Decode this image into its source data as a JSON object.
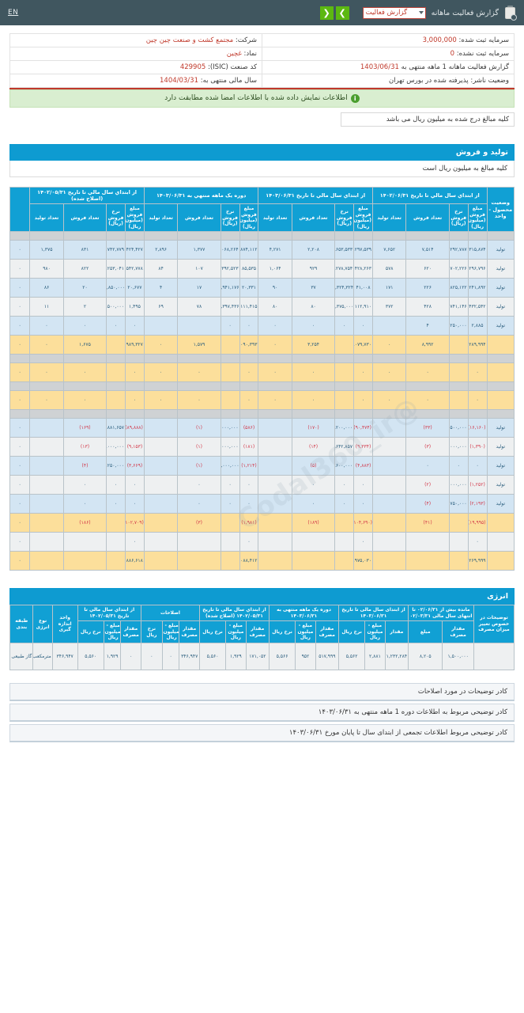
{
  "topbar": {
    "lang_link": "EN",
    "clipboard_icon": "clipboard-check-icon",
    "title": "گزارش فعالیت ماهانه",
    "report_select_value": "گزارش فعالیت",
    "prev_label": "❮",
    "next_label": "❯"
  },
  "info": {
    "company_label": "شرکت:",
    "company_value": "مجتمع کشت و صنعت چین چین",
    "symbol_label": "نماد:",
    "symbol_value": "غچین",
    "isic_label": "کد صنعت (ISIC):",
    "isic_value": "429905",
    "fiscal_year_label": "سال مالی منتهی به:",
    "fiscal_year_value": "1404/03/31",
    "registered_capital_label": "سرمایه ثبت شده:",
    "registered_capital_value": "3,000,000",
    "unregistered_capital_label": "سرمایه ثبت نشده:",
    "unregistered_capital_value": "0",
    "period_label": "گزارش فعالیت ماهانه  1 ماهه منتهی به",
    "period_value": "1403/06/31",
    "issuer_status_label": "وضعیت ناشر:",
    "issuer_status_value": "پذیرفته شده در بورس تهران"
  },
  "notice": {
    "icon": "info-icon",
    "text": "اطلاعات نمایش داده شده با اطلاعات امضا شده مطابقت دارد"
  },
  "unit_note": "کلیه مبالغ درج شده به میلیون ریال می باشد",
  "sales_section": {
    "header": "تولید و فروش",
    "subheader": "کلیه مبالغ به میلیون ریال است",
    "group_headers": [
      "از ابتداي سال مالي تا تاريخ ۱۴۰۲/۰۵/۳۱ (اصلاح شده)",
      "دوره يک ماهه منتهي به ۱۴۰۳/۰۶/۳۱",
      "از ابتداي سال مالي تا تاريخ ۱۴۰۳/۰۶/۳۱",
      "از ابتداي سال مالي تا تاريخ ۱۴۰۲/۰۶/۳۱",
      "وضعیت محصول - واحد"
    ],
    "sub_headers": [
      "مبلغ فروش (میلیون ریال)",
      "نرخ فروش (ریال)",
      "تعداد فروش",
      "تعداد تولید",
      "مبلغ فروش (میلیون ریال)",
      "نرخ فروش (ریال)",
      "تعداد فروش",
      "تعداد تولید",
      "مبلغ فروش (میلیون ریال)",
      "نرخ فروش (ریال)",
      "تعداد فروش",
      "تعداد تولید",
      "مبلغ فروش (میلیون ریال)",
      "نرخ فروش (ریال)",
      "تعداد فروش",
      "تعداد تولید"
    ],
    "rows": [
      {
        "style": "r-gray",
        "cells": [
          "",
          "",
          "",
          "",
          "",
          "",
          "",
          "",
          "",
          "",
          "",
          "",
          "",
          "",
          "",
          "",
          ""
        ]
      },
      {
        "style": "r-blue",
        "unit": "تولید",
        "cells": [
          "۳,۳۱۵,۸۷۴",
          "۴۴۱,۲۹۲,۷۸۷",
          "۷,۵۱۴",
          "۷,۶۵۲",
          "۱,۲۹۷,۵۳۹",
          "۵۸۷,۶۵۳,۵۳۳",
          "۲,۲۰۸",
          "۴,۲۷۱",
          "۸۷۴,۱۱۲",
          "۶۲۴,۰۶۸,۲۶۴",
          "۱,۳۷۷",
          "۲,۸۹۶",
          "۴۲۴,۴۲۷",
          "۵۱۰,۷۴۲,۷۷۹",
          "۸۳۱",
          "۱,۳۷۵",
          "۰"
        ]
      },
      {
        "style": "r-white",
        "unit": "تولید",
        "cells": [
          "۲۹۶,۷۹۶",
          "۴۷۸,۷۰۲,۲۲۶",
          "۶۲۰",
          "۵۷۸",
          "۴۲۸,۲۶۳",
          "۴۷۶,۲۷۸,۷۵۴",
          "۹۲۹",
          "۱,۰۶۴",
          "۸۵,۵۳۵",
          "۷۹۹,۳۹۲,۵۲۳",
          "۱۰۷",
          "۸۴",
          "۵۴۲,۷۷۸",
          "۶۶۰,۲۵۳,۰۴۱",
          "۸۲۲",
          "۹۸۰",
          "۰"
        ]
      },
      {
        "style": "r-blue",
        "unit": "تولید",
        "cells": [
          "۲۴۱,۸۹۲",
          "۹۸۱,۸۲۵,۱۲۲",
          "۲۲۶",
          "۱۷۱",
          "۴۱,۰۰۸",
          "۱,۱۰۸,۳۲۴,۳۲۴",
          "۳۷",
          "۹۰",
          "۲۰,۳۳۱",
          "۱,۱۹۵,۹۴۱,۱۷۶",
          "۱۷",
          "۴",
          "۲۰,۶۷۷",
          "۱,۰۳۳,۸۵۰,۰۰۰",
          "۲۰",
          "۸۶",
          "۰"
        ]
      },
      {
        "style": "r-white",
        "unit": "تولید",
        "cells": [
          "۴۳۲,۵۴۲",
          "۵۸۸,۷۴۱,۱۴۶",
          "۴۲۸",
          "۳۷۲",
          "۱۱۲,۹۱۰",
          "۱,۴۱۱,۳۷۵,۰۰۰",
          "۸۰",
          "۸۰",
          "۱۱۱,۴۱۵",
          "۱,۴۲۸,۳۹۷,۴۳۶",
          "۷۸",
          "۶۹",
          "۱,۴۹۵",
          "۷۴۷,۵۰۰,۰۰۰",
          "۲",
          "۱۱",
          "۰"
        ]
      },
      {
        "style": "r-blue",
        "unit": "تولید",
        "cells": [
          "۲,۸۸۵",
          "۷۲۱,۲۵۰,۰۰۰",
          "۴",
          "",
          "۰",
          "۰",
          "۰",
          "۰",
          "۰",
          "۰",
          "",
          "",
          "۰",
          "۰",
          "۰",
          "۰",
          "۰"
        ]
      },
      {
        "style": "r-yellow",
        "unit": "",
        "cells": [
          "۴,۲۸۹,۹۹۴",
          "",
          "۸,۹۹۲",
          "۰",
          "۲,۰۷۹,۷۳۰",
          "",
          "۳,۲۵۴",
          "۰",
          "۱,۰۹۰,۳۹۳",
          "",
          "۱,۵۷۹",
          "۰",
          "۹۸۹,۳۲۷",
          "",
          "۱,۶۷۵",
          "۰",
          "۰"
        ]
      },
      {
        "style": "r-gray",
        "cells": [
          "",
          "",
          "",
          "",
          "",
          "",
          "",
          "",
          "",
          "",
          "",
          "",
          "",
          "",
          "",
          "",
          ""
        ]
      },
      {
        "style": "r-yellow",
        "unit": "",
        "cells": [
          "۰",
          "",
          "۰",
          "۰",
          "۰",
          "",
          "۰",
          "۰",
          "۰",
          "",
          "۰",
          "۰",
          "۰",
          "",
          "۰",
          "۰",
          "۰"
        ]
      },
      {
        "style": "r-gray",
        "cells": [
          "",
          "",
          "",
          "",
          "",
          "",
          "",
          "",
          "",
          "",
          "",
          "",
          "",
          "",
          "",
          "",
          ""
        ]
      },
      {
        "style": "r-yellow",
        "unit": "",
        "cells": [
          "۰",
          "",
          "۰",
          "۰",
          "۰",
          "",
          "۰",
          "۰",
          "۰",
          "",
          "۰",
          "۰",
          "۰",
          "",
          "۰",
          "۰",
          "۰"
        ]
      },
      {
        "style": "r-gray",
        "cells": [
          "",
          "",
          "",
          "",
          "",
          "",
          "",
          "",
          "",
          "",
          "",
          "",
          "",
          "",
          "",
          "",
          ""
        ]
      },
      {
        "style": "r-blue",
        "unit": "تولید",
        "neg": true,
        "cells": [
          "(۱۶,۱۶۰)",
          "۴۴۲,۵۰۰,۰۰۰",
          "(۳۳)",
          "",
          "(۹۰,۴۷۴)",
          "۵۳۲,۲۰۰,۰۰۰",
          "(۱۷۰)",
          "",
          "(۵۸۶)",
          "۵۸۶,۰۰۰,۰۰۰",
          "(۱)",
          "",
          "(۸۹,۸۸۸)",
          "۵۳۱,۸۸۱,۶۵۷",
          "(۱۶۹)",
          "",
          "۰"
        ]
      },
      {
        "style": "r-white",
        "unit": "تولید",
        "neg": true,
        "cells": [
          "(۱,۳۹۰)",
          "۴۳۰,۰۰۰,۰۰۰",
          "(۳)",
          "",
          "(۹,۳۳۴)",
          "۶۶۶,۶۴۲,۸۵۷",
          "(۱۴)",
          "",
          "(۱۸۱)",
          "۱۸۱,۰۰۰,۰۰۰",
          "(۱)",
          "",
          "(۹,۱۵۳)",
          "۷۰۴,۰۰۰,۰۰۰",
          "(۱۳)",
          "",
          "۰"
        ]
      },
      {
        "style": "r-blue",
        "unit": "تولید",
        "neg": true,
        "cells": [
          "۰",
          "۰",
          "۰",
          "",
          "(۴,۸۸۳)",
          "۹۷۶,۶۰۰,۰۰۰",
          "(۵)",
          "",
          "(۱,۲۱۴)",
          "۱,۲۱۴,۰۰۰,۰۰۰",
          "(۱)",
          "",
          "(۳,۶۶۹)",
          "۹۱۷,۲۵۰,۰۰۰",
          "(۴)",
          "",
          "۰"
        ]
      },
      {
        "style": "r-white",
        "unit": "تولید",
        "neg": true,
        "cells": [
          "(۱,۲۵۲)",
          "۶۲۶,۰۰۰,۰۰۰",
          "(۲)",
          "",
          "۰",
          "۰",
          "۰",
          "",
          "۰",
          "۰",
          "۰",
          "",
          "۰",
          "۰",
          "۰",
          "",
          "۰"
        ]
      },
      {
        "style": "r-blue",
        "unit": "تولید",
        "neg": true,
        "cells": [
          "(۲,۱۹۳)",
          "۷۹۸,۷۵۰,۰۰۰",
          "(۴)",
          "",
          "۰",
          "۰",
          "۰",
          "",
          "۰",
          "۰",
          "۰",
          "",
          "۰",
          "۰",
          "۰",
          "",
          "۰"
        ]
      },
      {
        "style": "r-yellow",
        "unit": "",
        "neg": true,
        "cells": [
          "(۱۹,۹۹۵)",
          "",
          "(۴۱)",
          "",
          "(۱۰۴,۶۹۰)",
          "",
          "(۱۸۹)",
          "",
          "(۱,۹۸۱)",
          "",
          "(۳)",
          "",
          "(۱۰۲,۷۰۹)",
          "",
          "(۱۸۶)",
          "",
          "۰"
        ]
      },
      {
        "style": "r-white",
        "unit": "",
        "cells": [
          "۰",
          "",
          "",
          "",
          "۰",
          "",
          "",
          "",
          "۰",
          "",
          "",
          "",
          "۰",
          "",
          "",
          "",
          "۰"
        ]
      },
      {
        "style": "r-yellow",
        "unit": "",
        "cells": [
          "۴,۲۶۹,۹۹۹",
          "",
          "",
          "",
          "۱,۹۷۵,۰۳۰",
          "",
          "",
          "",
          "۱,۰۸۸,۴۱۲",
          "",
          "",
          "",
          "۸۸۶,۶۱۸",
          "",
          "",
          "",
          "۰"
        ]
      }
    ]
  },
  "energy_section": {
    "header": "انرژی",
    "group_headers": [
      "توضیحات در خصوص تغییر میزان مصرف",
      "مانده بیش از ۰۲/۰۶/۳۱ تا انتهای سال مالی ۰۲/۰۳/۳۱",
      "از ابتدای سال مالی تا تاریخ ۱۴۰۳/۰۶/۳۱",
      "از ابتدای سال مالی تا تاریخ ۱۴۰۳/۰۶/۳۱",
      "دوره یک ماهه منتهی به ۱۴۰۳/۰۶/۳۱",
      "از ابتداي سال مالي تا تاريخ ۱۴۰۲/۰۵/۳۱ (اصلاح شده)",
      "اصلاحات",
      "از ابتداي سال مالي تا تاريخ ۱۴۰۲/۰۵/۳۱",
      "واحد اندازه گیری",
      "نوع انرژی",
      "طبقه بندی"
    ],
    "sub_headers": [
      "مقدار مصرف",
      "مبلغ",
      "مقدار",
      "مبلغ - میلیون ریال",
      "نرخ ریال",
      "مقدار مصرف",
      "مبلغ - میلیون ریال",
      "نرخ ریال",
      "مقدار مصرف",
      "مبلغ - میلیون ریال",
      "نرخ ریال",
      "مقدار مصرف",
      "مبلغ - میلیون ریال",
      "نرخ ریال",
      "مقدار مصرف",
      "مبلغ - میلیون ریال",
      "نرخ ریال",
      "مقدار مصرف"
    ],
    "row": {
      "category": "سوخت",
      "energy_type": "گاز طبیعی",
      "unit": "مترمکعب",
      "values": [
        "۱,۵۰۰,۰۰۰",
        "۸,۲۰۵",
        "۱,۲۳۲,۲۸۴",
        "۲,۸۸۱",
        "۵,۵۶۲",
        "۵۱۷,۹۹۹",
        "۹۵۲",
        "۵,۵۶۶",
        "۱۷۱,۰۵۲",
        "۱,۹۲۹",
        "۵,۵۶۰",
        "۳۴۶,۹۴۷",
        "۰",
        "۰",
        "۰",
        "۱,۹۲۹",
        "۵,۵۶۰",
        "۳۴۶,۹۴۷"
      ]
    }
  },
  "footer_notes": [
    "کادر توضیحات در مورد اصلاحات",
    "کادر توضیحی مربوط به اطلاعات دوره 1 ماهه منتهی به ۱۴۰۳/۰۶/۳۱",
    "کادر توضیحی مربوط اطلاعات تجمعی از ابتدای سال تا پایان مورخ ۱۴۰۳/۰۶/۳۱"
  ],
  "watermark": "@Codal360_ir",
  "colors": {
    "topbar": "#40565f",
    "accent": "#0e9bd1",
    "green": "#5cb811",
    "red": "#c0392b",
    "yellow_row": "#fcdf9b",
    "blue_row": "#d3e5f3"
  }
}
